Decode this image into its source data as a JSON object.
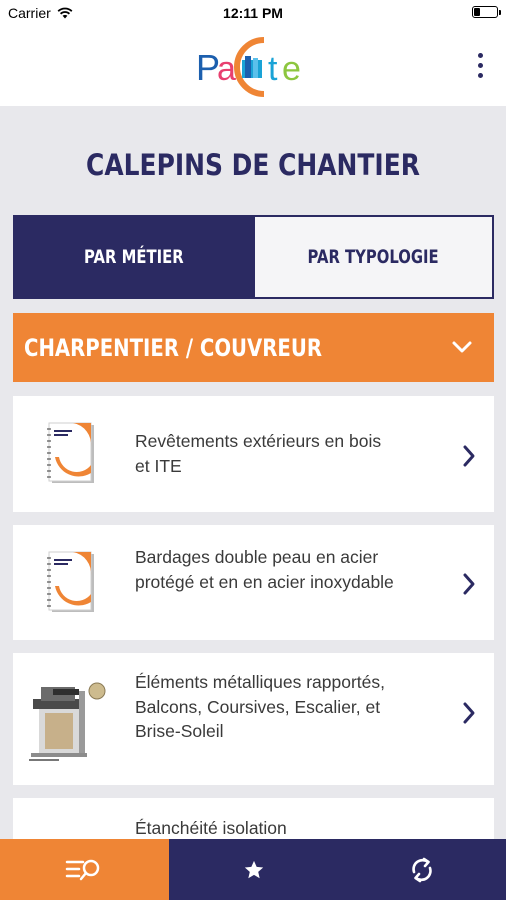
{
  "status_bar": {
    "carrier": "Carrier",
    "time": "12:11 PM",
    "battery_level": 0.3
  },
  "header": {
    "logo": {
      "text": "PaCte",
      "colors": [
        "#1c5fae",
        "#e83f6f",
        "#ef8535",
        "#1aa3d6",
        "#8dc63f"
      ]
    }
  },
  "page": {
    "title": "CALEPINS DE CHANTIER"
  },
  "segments": [
    {
      "label": "PAR MÉTIER",
      "selected": true
    },
    {
      "label": "PAR TYPOLOGIE",
      "selected": false
    }
  ],
  "category": {
    "label": "CHARPENTIER / COUVREUR",
    "expanded": true
  },
  "items": [
    {
      "title": "Revêtements extérieurs en bois et ITE",
      "thumb": "booklet-icon"
    },
    {
      "title": "Bardages double peau en acier protégé et en en acier inoxydable",
      "thumb": "booklet-icon"
    },
    {
      "title": "Éléments métalliques rapportés, Balcons, Coursives, Escalier, et Brise-Soleil",
      "thumb": "building-detail-image"
    },
    {
      "title": "Étanchéité isolation",
      "thumb": "booklet-icon"
    }
  ],
  "tabbar": [
    {
      "name": "search-list-icon",
      "selected": true
    },
    {
      "name": "star-icon",
      "selected": false
    },
    {
      "name": "sync-icon",
      "selected": false
    }
  ],
  "colors": {
    "navy": "#2b2a62",
    "orange": "#ef8535",
    "background": "#e8e8ec"
  }
}
